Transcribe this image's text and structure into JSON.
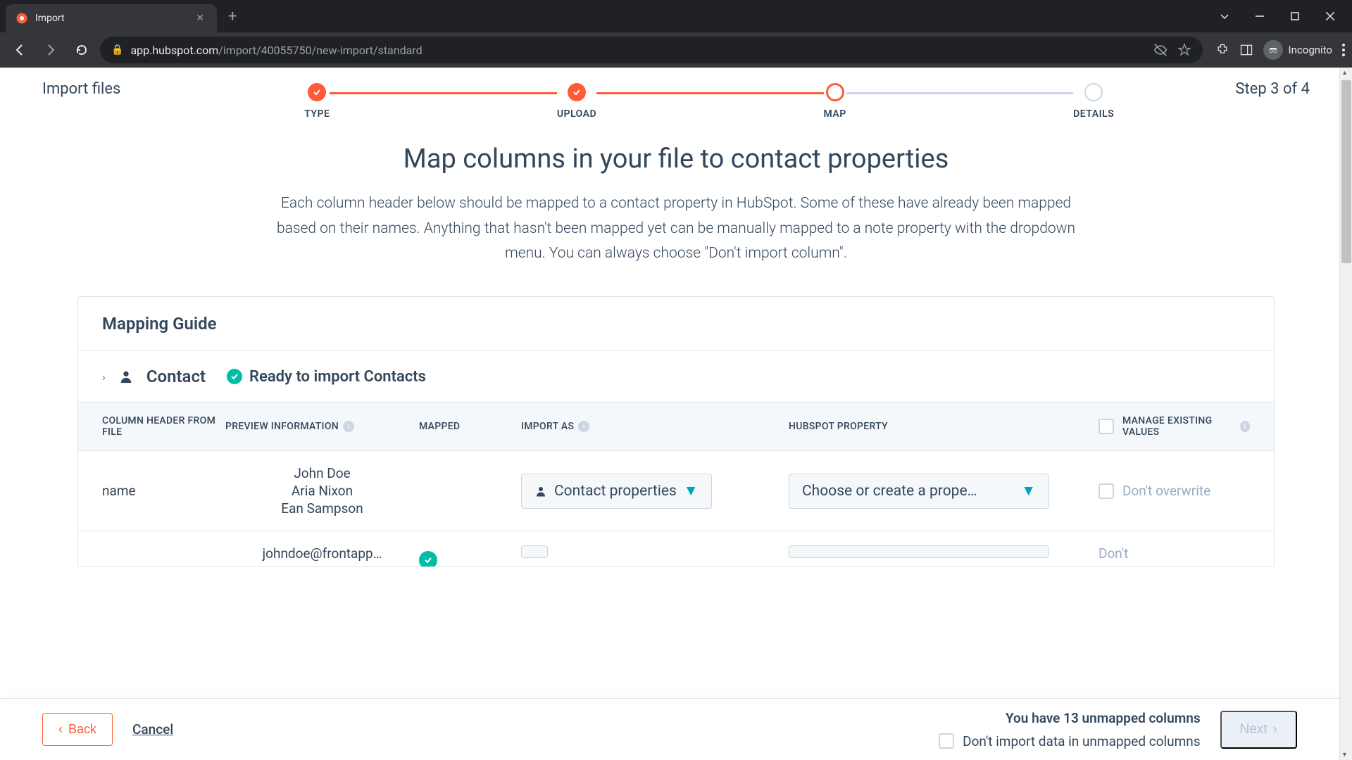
{
  "browser": {
    "tab_title": "Import",
    "url_host": "app.hubspot.com",
    "url_path": "/import/40055750/new-import/standard",
    "incognito_label": "Incognito"
  },
  "header": {
    "left": "Import files",
    "right": "Step 3 of 4"
  },
  "stepper": {
    "steps": [
      "TYPE",
      "UPLOAD",
      "MAP",
      "DETAILS"
    ]
  },
  "content": {
    "title": "Map columns in your file to contact properties",
    "description": "Each column header below should be mapped to a contact property in HubSpot. Some of these have already been mapped based on their names. Anything that hasn't been mapped yet can be manually mapped to a note property with the dropdown menu. You can always choose \"Don't import column\"."
  },
  "panel": {
    "title": "Mapping Guide",
    "accordion_label": "Contact",
    "ready_text": "Ready to import Contacts"
  },
  "table": {
    "headers": {
      "col1": "COLUMN HEADER FROM FILE",
      "col2": "PREVIEW INFORMATION",
      "col3": "MAPPED",
      "col4": "IMPORT AS",
      "col5": "HUBSPOT PROPERTY",
      "col6": "MANAGE EXISTING VALUES"
    },
    "rows": [
      {
        "header": "name",
        "preview": [
          "John Doe",
          "Aria Nixon",
          "Ean Sampson"
        ],
        "import_as": "Contact properties",
        "hubspot_property": "Choose or create a prope…",
        "manage": "Don't overwrite"
      },
      {
        "header": "",
        "preview": [
          "johndoe@frontapp…"
        ],
        "import_as": "",
        "hubspot_property": "",
        "manage": "Don't"
      }
    ]
  },
  "footer": {
    "back": "Back",
    "cancel": "Cancel",
    "unmapped_title": "You have 13 unmapped columns",
    "unmapped_checkbox": "Don't import data in unmapped columns",
    "next": "Next"
  }
}
